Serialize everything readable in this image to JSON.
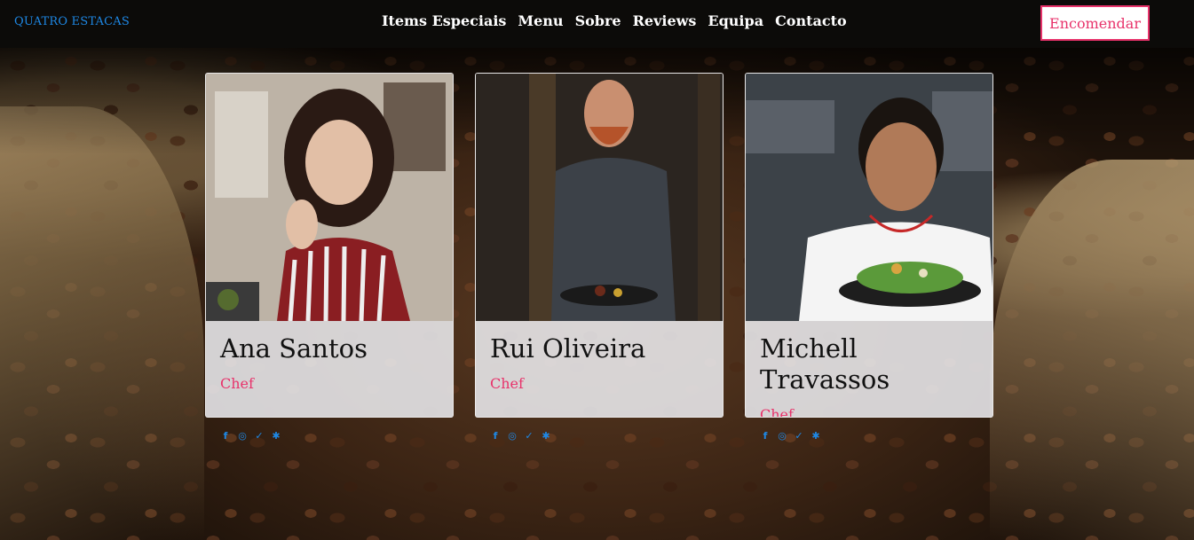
{
  "nav": {
    "brand": "QUATRO ESTACAS",
    "links": [
      "Items Especiais",
      "Menu",
      "Sobre",
      "Reviews",
      "Equipa",
      "Contacto"
    ],
    "order_label": "Encomendar"
  },
  "team": [
    {
      "name": "Ana Santos",
      "role": "Chef"
    },
    {
      "name": "Rui Oliveira",
      "role": "Chef"
    },
    {
      "name": "Michell Travassos",
      "role": "Chef"
    }
  ],
  "social_icons": [
    "facebook-icon",
    "instagram-icon",
    "twitter-icon",
    "yelp-icon"
  ],
  "colors": {
    "brand": "#1e88e5",
    "accent": "#e8336b",
    "nav_bg": "#0c0b09"
  }
}
